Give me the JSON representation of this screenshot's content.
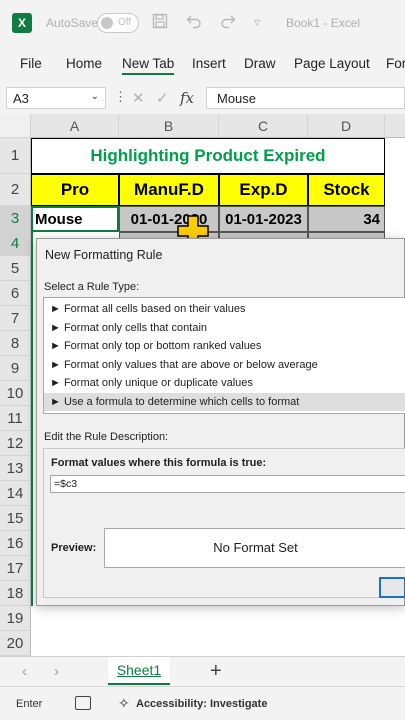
{
  "titlebar": {
    "autosave_label": "AutoSave",
    "autosave_state": "Off",
    "doc_title": "Book1  -  Excel"
  },
  "ribbon": {
    "tabs": [
      "File",
      "Home",
      "New Tab",
      "Insert",
      "Draw",
      "Page Layout",
      "For"
    ],
    "active_tab": "New Tab"
  },
  "formula_bar": {
    "name_box": "A3",
    "fx": "fx",
    "content": "Mouse"
  },
  "sheet": {
    "columns": [
      "A",
      "B",
      "C",
      "D"
    ],
    "rows": [
      "1",
      "2",
      "3",
      "4",
      "5",
      "6",
      "7",
      "8",
      "9",
      "10",
      "11",
      "12",
      "13",
      "14",
      "15",
      "16",
      "17",
      "18",
      "19",
      "20"
    ],
    "title": "Highlighting Product Expired",
    "headers": [
      "Pro",
      "ManuF.D",
      "Exp.D",
      "Stock"
    ],
    "row3": [
      "Mouse",
      "01-01-2020",
      "01-01-2023",
      "34"
    ]
  },
  "dialog": {
    "title": "New Formatting Rule",
    "select_rule_label": "Select a Rule Type:",
    "rules": [
      "► Format all cells based on their values",
      "► Format only cells that contain",
      "► Format only top or bottom ranked values",
      "► Format only values that are above or below average",
      "► Format only unique or duplicate values",
      "► Use a formula to determine which cells to format"
    ],
    "selected_rule_index": 5,
    "edit_label": "Edit the Rule Description:",
    "format_values_label": "Format values where this formula is true:",
    "formula": "=$c3",
    "preview_label": "Preview:",
    "preview_text": "No Format Set"
  },
  "sheet_tabs": {
    "active": "Sheet1",
    "add": "+"
  },
  "status_bar": {
    "mode": "Enter",
    "accessibility": "Accessibility: Investigate"
  },
  "colors": {
    "excel_green": "#107c41",
    "title_green": "#00a04a",
    "header_yellow": "#ffff00",
    "data_gray": "#c8c8c8"
  }
}
